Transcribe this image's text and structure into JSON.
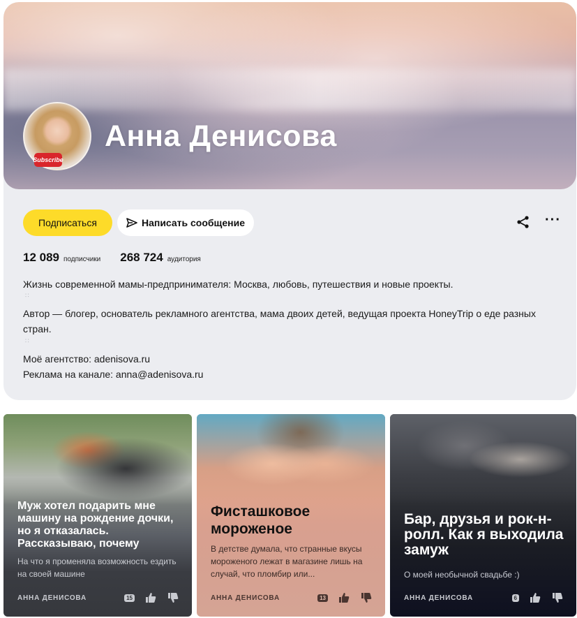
{
  "profile": {
    "name": "Анна Денисова",
    "avatar_badge": "Subscribe",
    "subscribe_label": "Подписаться",
    "message_label": "Написать сообщение",
    "stats": {
      "subscribers_count": "12 089",
      "subscribers_label": "подписчики",
      "audience_count": "268 724",
      "audience_label": "аудитория"
    },
    "description": {
      "line1": "Жизнь современной мамы-предпринимателя: Москва, любовь, путешествия и новые проекты.",
      "line2": "Автор — блогер, основатель рекламного агентства, мама двоих детей, ведущая проекта HoneyTrip о еде разных стран.",
      "line3": "Моё агентство: adenisova.ru",
      "line4": "Реклама на канале: anna@adenisova.ru"
    },
    "icons": {
      "share": "share-icon",
      "more": "more-icon",
      "message": "send-icon"
    },
    "colors": {
      "subscribe_button": "#fddb29",
      "card_bg": "#ecedf1"
    }
  },
  "articles": [
    {
      "title": "Муж хотел подарить мне машину на рождение дочки, но я отказалась. Рассказываю, почему",
      "subtitle": "На что я променяла возможность ездить на своей машине",
      "author": "АННА ДЕНИСОВА",
      "comments": "15"
    },
    {
      "title": "Фисташковое мороженое",
      "subtitle": "В детстве думала, что странные вкусы мороженого лежат в магазине лишь на случай, что пломбир или...",
      "author": "АННА ДЕНИСОВА",
      "comments": "13"
    },
    {
      "title": "Бар, друзья и рок-н-ролл. Как я выходила замуж",
      "subtitle": "О моей необычной свадьбе :)",
      "author": "АННА ДЕНИСОВА",
      "comments": "6"
    }
  ]
}
